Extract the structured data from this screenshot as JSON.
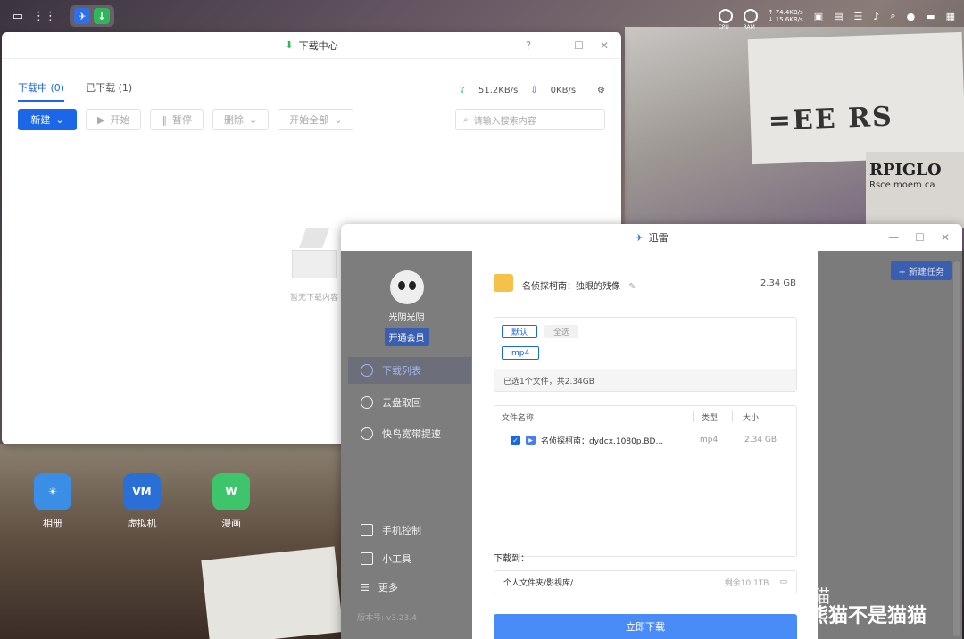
{
  "taskbar": {
    "cpu_label": "CPU",
    "ram_label": "RAM",
    "net_up": "↑ 74.4KB/s",
    "net_down": "↓ 15.6KB/s"
  },
  "download_center": {
    "title": "下载中心",
    "tabs": [
      {
        "label": "下载中 (0)",
        "active": true
      },
      {
        "label": "已下载 (1)",
        "active": false
      }
    ],
    "upload_speed": "51.2KB/s",
    "download_speed": "0KB/s",
    "toolbar": {
      "new": "新建",
      "start": "开始",
      "pause": "暂停",
      "delete": "删除",
      "start_all": "开始全部"
    },
    "search_placeholder": "请输入搜索内容",
    "empty_text": "暂无下载内容"
  },
  "desktop_icons": [
    {
      "label": "相册",
      "color": "#3a8ee6"
    },
    {
      "label": "虚拟机",
      "color": "#2a6fd6"
    },
    {
      "label": "漫画",
      "color": "#3ec46a"
    }
  ],
  "xunlei": {
    "title": "迅雷",
    "user_name": "光阴光阴",
    "vip_button": "开通会员",
    "nav": [
      {
        "label": "下载列表",
        "active": true
      },
      {
        "label": "云盘取回",
        "active": false
      },
      {
        "label": "快鸟宽带提速",
        "active": false
      }
    ],
    "tools": [
      {
        "label": "手机控制"
      },
      {
        "label": "小工具"
      },
      {
        "label": "更多"
      }
    ],
    "version": "版本号: v3.23.4",
    "new_task": "+ 新建任务",
    "dialog": {
      "folder_name": "名侦探柯南：独眼的残像",
      "folder_size": "2.34 GB",
      "options": {
        "default": "默认",
        "select_all": "全选",
        "format": "mp4"
      },
      "selection_summary": "已选1个文件，共2.34GB",
      "table_headers": {
        "name": "文件名称",
        "type": "类型",
        "size": "大小"
      },
      "files": [
        {
          "name": "名侦探柯南：dydcx.1080p.BD...",
          "type": "mp4",
          "size": "2.34 GB",
          "checked": true
        }
      ],
      "download_to_label": "下载到：",
      "path": "个人文件夹/影视库/",
      "remaining": "剩余10.1TB",
      "download_button": "立即下载"
    }
  },
  "watermark": {
    "text1": "公众号 · Panda不是猫",
    "text2": "熊猫不是猫猫"
  }
}
